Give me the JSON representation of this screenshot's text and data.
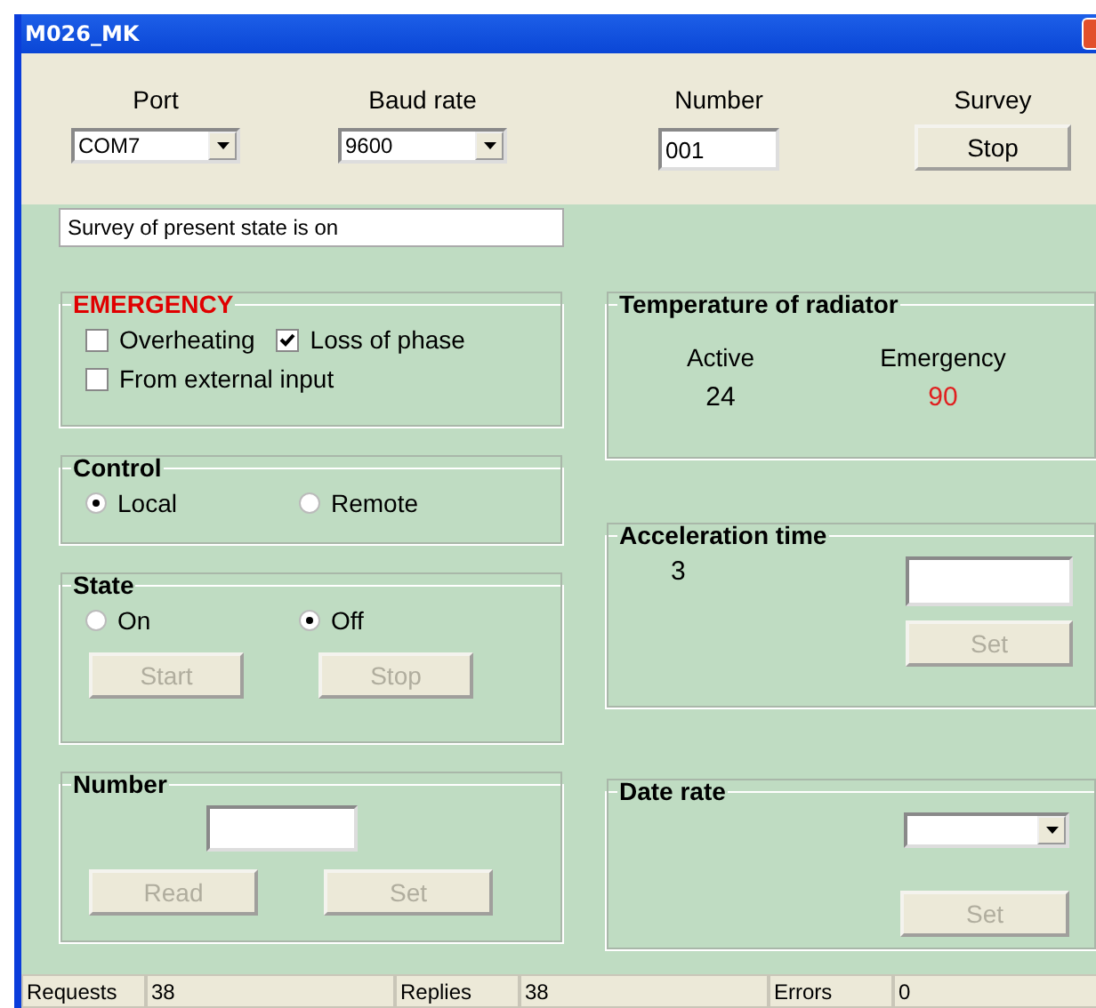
{
  "window": {
    "title": "M026_MK"
  },
  "top": {
    "port": {
      "label": "Port",
      "value": "COM7"
    },
    "baud_rate": {
      "label": "Baud rate",
      "value": "9600"
    },
    "number": {
      "label": "Number",
      "value": "001"
    },
    "survey": {
      "label": "Survey",
      "button": {
        "label": "Stop",
        "disabled": false
      }
    }
  },
  "status_message": "Survey of present state is on",
  "emergency": {
    "title": "EMERGENCY",
    "options": [
      {
        "label": "Overheating",
        "checked": false
      },
      {
        "label": "Loss of phase",
        "checked": true
      },
      {
        "label": "From external input",
        "checked": false
      }
    ]
  },
  "control": {
    "title": "Control",
    "options": [
      {
        "label": "Local",
        "selected": true
      },
      {
        "label": "Remote",
        "selected": false
      }
    ]
  },
  "state": {
    "title": "State",
    "options": [
      {
        "label": "On",
        "selected": false
      },
      {
        "label": "Off",
        "selected": true
      }
    ],
    "buttons": [
      {
        "label": "Start",
        "disabled": true
      },
      {
        "label": "Stop",
        "disabled": true
      }
    ]
  },
  "number_group": {
    "title": "Number",
    "buttons": [
      {
        "label": "Read",
        "disabled": true
      },
      {
        "label": "Set",
        "disabled": true
      }
    ]
  },
  "temperature": {
    "title": "Temperature of radiator",
    "active": {
      "label": "Active",
      "value": "24"
    },
    "emergency": {
      "label": "Emergency",
      "value": "90"
    }
  },
  "acceleration": {
    "title": "Acceleration time",
    "value": "3",
    "button": {
      "label": "Set",
      "disabled": true
    }
  },
  "date_rate": {
    "title": "Date rate",
    "button": {
      "label": "Set",
      "disabled": true
    }
  },
  "status_bar": [
    {
      "label": "Requests",
      "value": "38"
    },
    {
      "label": "Replies",
      "value": "38"
    },
    {
      "label": "Errors",
      "value": "0"
    }
  ]
}
